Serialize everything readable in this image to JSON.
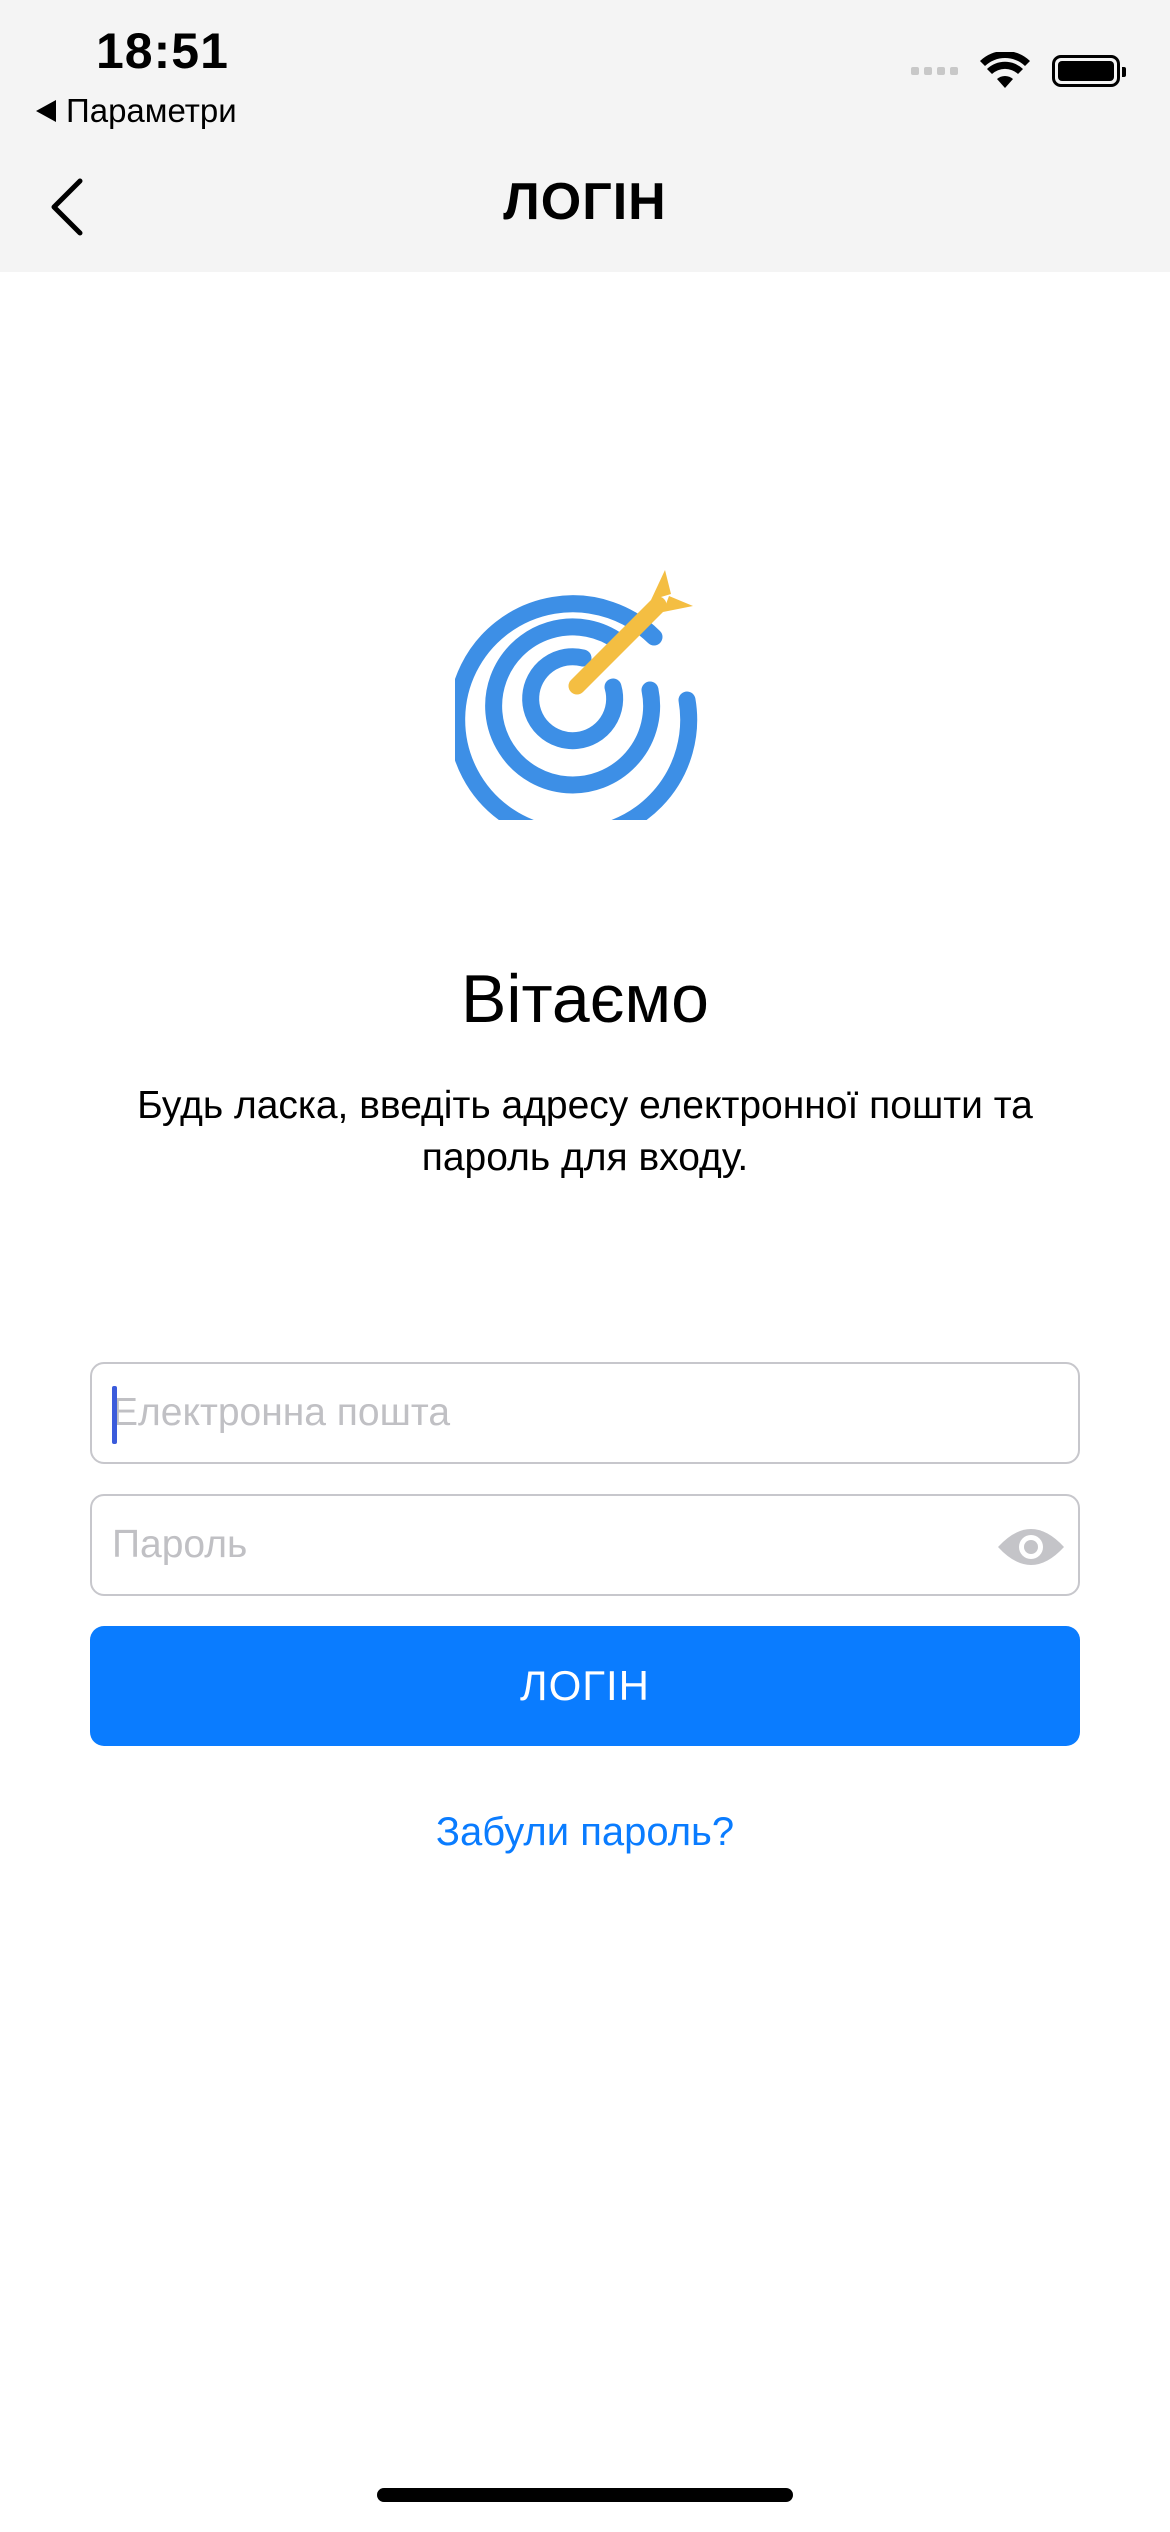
{
  "status_bar": {
    "time": "18:51",
    "back_app_label": "Параметри",
    "icons": [
      "cellular-signal-icon",
      "wifi-icon",
      "battery-icon"
    ]
  },
  "nav": {
    "back_icon": "chevron-left-icon",
    "title": "ЛОГІН"
  },
  "hero": {
    "logo_icon": "target-arrow-icon",
    "title": "Вітаємо",
    "subtitle": "Будь ласка, введіть адресу електронної пошти та пароль для входу."
  },
  "form": {
    "email": {
      "placeholder": "Електронна пошта",
      "value": ""
    },
    "password": {
      "placeholder": "Пароль",
      "value": "",
      "toggle_icon": "eye-icon"
    },
    "login_button_label": "ЛОГІН",
    "forgot_password_label": "Забули пароль?"
  },
  "colors": {
    "accent": "#0A7CFF",
    "logo_blue": "#3D8FE6",
    "logo_yellow": "#F4BE42",
    "nav_background": "#F4F4F4"
  }
}
